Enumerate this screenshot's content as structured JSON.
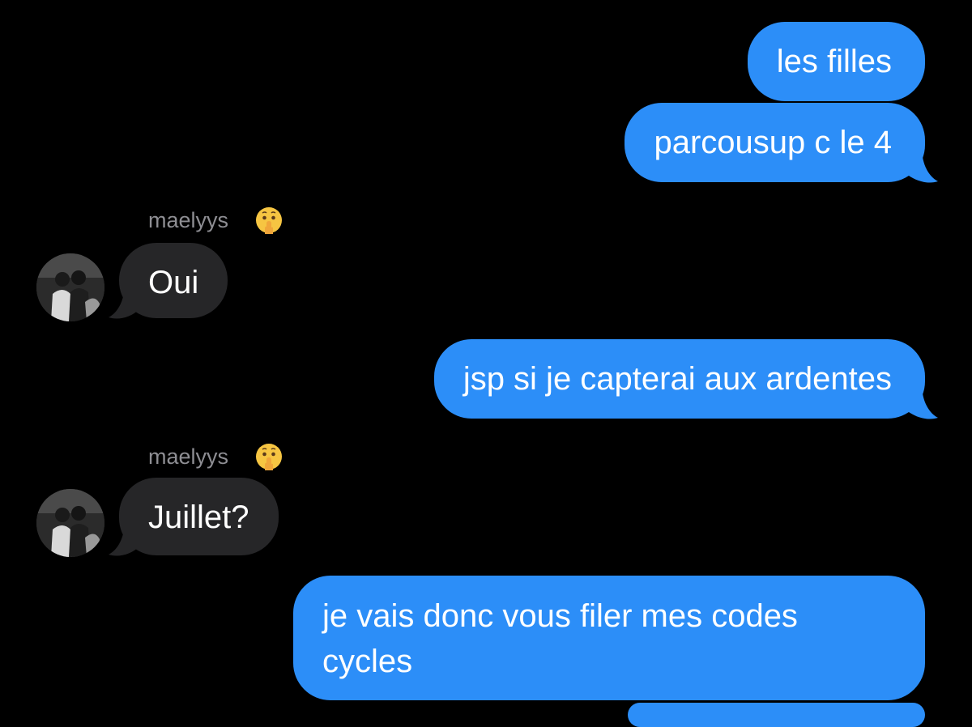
{
  "conversation": {
    "messages": [
      {
        "direction": "outgoing",
        "text": "les filles"
      },
      {
        "direction": "outgoing",
        "text": "parcousup c le 4"
      },
      {
        "direction": "incoming",
        "sender": "maelyys",
        "text": "Oui"
      },
      {
        "direction": "outgoing",
        "text": "jsp si je capterai aux ardentes"
      },
      {
        "direction": "incoming",
        "sender": "maelyys",
        "text": "Juillet?"
      },
      {
        "direction": "outgoing",
        "text": "je vais donc vous filer mes codes cycles"
      }
    ],
    "sender_emoji_icon": "shushing-face-icon"
  },
  "colors": {
    "background": "#000000",
    "outgoing_bubble": "#2c8ef8",
    "incoming_bubble": "#262628",
    "sender_name": "#8e8e93",
    "text": "#ffffff"
  }
}
